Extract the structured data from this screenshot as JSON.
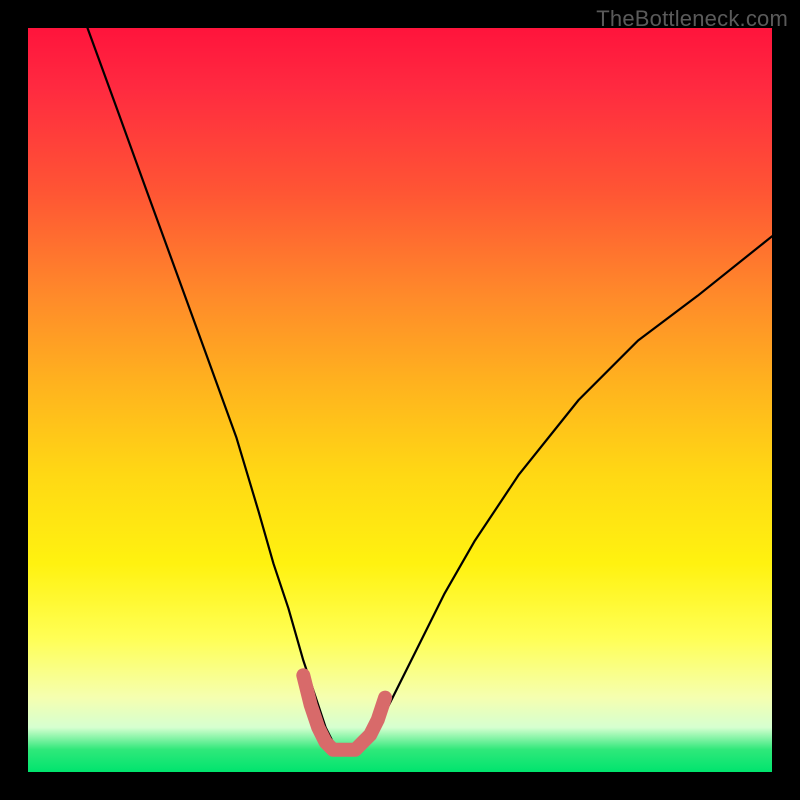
{
  "watermark": "TheBottleneck.com",
  "chart_data": {
    "type": "line",
    "title": "",
    "xlabel": "",
    "ylabel": "",
    "xlim": [
      0,
      100
    ],
    "ylim": [
      0,
      100
    ],
    "grid": false,
    "series": [
      {
        "name": "bottleneck-curve",
        "x": [
          8,
          12,
          16,
          20,
          24,
          28,
          31,
          33,
          35,
          37,
          39,
          40,
          41,
          42,
          43,
          44,
          45,
          47,
          49,
          52,
          56,
          60,
          66,
          74,
          82,
          90,
          100
        ],
        "values": [
          100,
          89,
          78,
          67,
          56,
          45,
          35,
          28,
          22,
          15,
          9,
          6,
          4,
          3,
          3,
          3,
          4,
          6,
          10,
          16,
          24,
          31,
          40,
          50,
          58,
          64,
          72
        ]
      },
      {
        "name": "sweet-spot",
        "x": [
          37,
          38,
          39,
          40,
          41,
          42,
          43,
          44,
          45,
          46,
          47,
          48
        ],
        "values": [
          13,
          9,
          6,
          4,
          3,
          3,
          3,
          3,
          4,
          5,
          7,
          10
        ]
      }
    ],
    "colors": {
      "curve": "#000000",
      "sweet_spot": "#d86a6a"
    }
  }
}
